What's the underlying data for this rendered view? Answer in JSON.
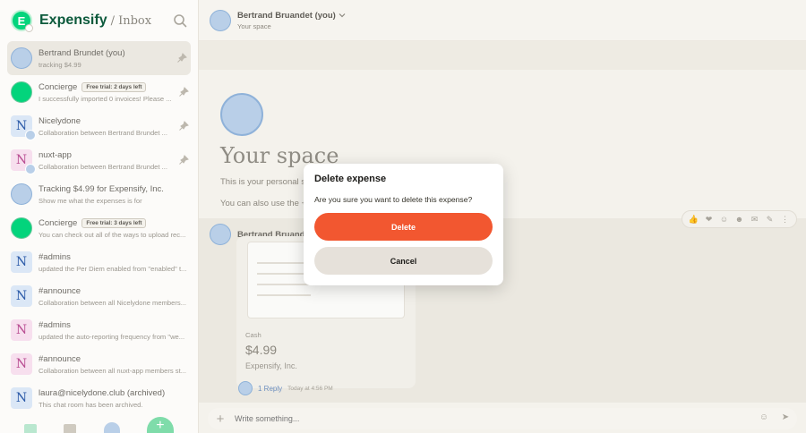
{
  "sidebar": {
    "brand": "Expensify",
    "crumb": "/ Inbox",
    "logo_letter": "E",
    "chats": [
      {
        "title": "Bertrand Brundet (you)",
        "subtitle": "tracking $4.99",
        "avatar": "user",
        "pinned": true,
        "active": true
      },
      {
        "title": "Concierge",
        "badge": "Free trial: 2 days left",
        "subtitle": "I successfully imported 0 invoices! Please ...",
        "avatar": "concierge",
        "pinned": true
      },
      {
        "title": "Nicelydone",
        "subtitle": "Collaboration between Bertrand Brundet ...",
        "avatar": "sq-blue",
        "letter": "N",
        "pinned": true
      },
      {
        "title": "nuxt-app",
        "subtitle": "Collaboration between Bertrand Brundet ...",
        "avatar": "sq-pink",
        "letter": "N",
        "pinned": true
      },
      {
        "title": "Tracking $4.99 for Expensify, Inc.",
        "subtitle": "Show me what the expenses is for",
        "avatar": "user"
      },
      {
        "title": "Concierge",
        "badge": "Free trial: 3 days left",
        "subtitle": "You can check out all of the ways to upload rec...",
        "avatar": "concierge"
      },
      {
        "title": "#admins",
        "subtitle": "updated the Per Diem enabled from \"enabled\" t...",
        "avatar": "sq-blue",
        "letter": "N"
      },
      {
        "title": "#announce",
        "subtitle": "Collaboration between all Nicelydone members...",
        "avatar": "sq-blue",
        "letter": "N"
      },
      {
        "title": "#admins",
        "subtitle": "updated the auto-reporting frequency from \"we...",
        "avatar": "sq-pink",
        "letter": "N"
      },
      {
        "title": "#announce",
        "subtitle": "Collaboration between all nuxt-app members st...",
        "avatar": "sq-pink",
        "letter": "N"
      },
      {
        "title": "laura@nicelydone.club (archived)",
        "subtitle": "This chat room has been archived.",
        "avatar": "sq-blue",
        "letter": "N"
      }
    ]
  },
  "header": {
    "title": "Bertrand Bruandet (you)",
    "subtitle": "Your space"
  },
  "welcome": {
    "title": "Your space",
    "line1": "This is your personal sp",
    "line2": "You can also use the + b"
  },
  "message": {
    "author": "Bertrand Bruande",
    "receipt_label": "Cash",
    "amount": "$4.99",
    "merchant": "Expensify, Inc.",
    "reply": "1 Reply",
    "reply_time": "Today at 4:56 PM"
  },
  "composer": {
    "placeholder": "Write something..."
  },
  "modal": {
    "title": "Delete expense",
    "text": "Are you sure you want to delete this expense?",
    "delete_label": "Delete",
    "cancel_label": "Cancel"
  },
  "colors": {
    "delete_button": "#f25730",
    "brand_green": "#03d47c",
    "cancel_button": "#e6e1da"
  }
}
